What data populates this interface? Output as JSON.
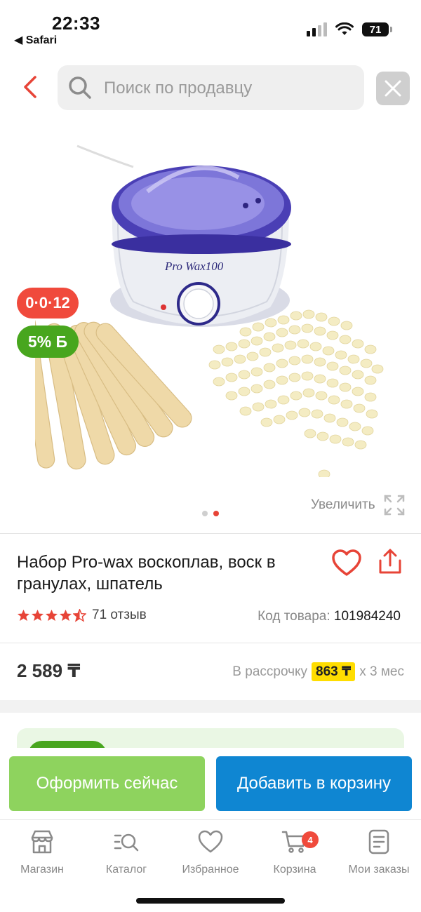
{
  "status_bar": {
    "time": "22:33",
    "back_app": "◀ Safari",
    "battery": "71"
  },
  "search": {
    "placeholder": "Поиск по продавцу"
  },
  "product": {
    "image_label": "Pro Wax100",
    "badge_installment": "0·0·12",
    "badge_bonus": "5% Б",
    "zoom_label": "Увеличить",
    "gallery_count": 2,
    "gallery_active": 2,
    "title": "Набор Pro-wax воскоплав, воск в гранулах, шпатель",
    "rating": 4.5,
    "reviews": "71 отзыв",
    "sku_label": "Код товара:",
    "sku_value": "101984240",
    "price": "2 589 ₸",
    "installment_prefix": "В рассрочку",
    "installment_amount": "863 ₸",
    "installment_suffix": "х 3 мес"
  },
  "actions": {
    "buy_now": "Оформить сейчас",
    "add_to_cart": "Добавить в корзину"
  },
  "bottom_nav": {
    "items": [
      {
        "label": "Магазин",
        "icon": "store-icon"
      },
      {
        "label": "Каталог",
        "icon": "catalog-icon"
      },
      {
        "label": "Избранное",
        "icon": "heart-icon"
      },
      {
        "label": "Корзина",
        "icon": "cart-icon",
        "badge": "4"
      },
      {
        "label": "Мои заказы",
        "icon": "orders-icon"
      }
    ]
  },
  "colors": {
    "accent_red": "#e74437",
    "green": "#48a61e",
    "blue": "#0f86d2",
    "yellow": "#ffdd00"
  }
}
